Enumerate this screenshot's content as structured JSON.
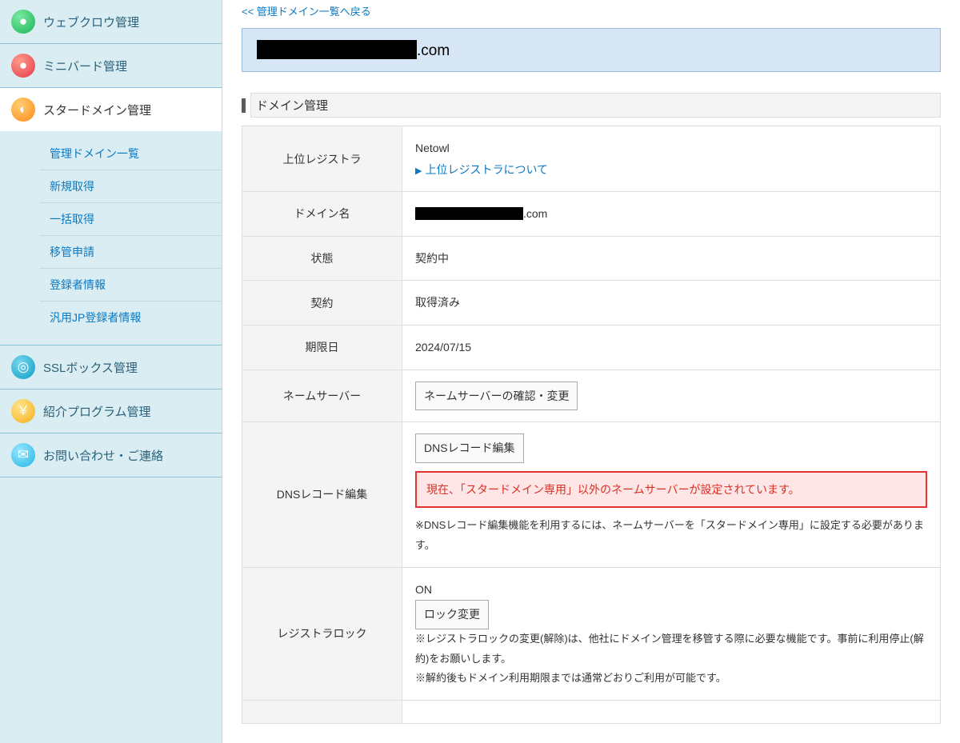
{
  "sidebar": {
    "group0": {
      "label": "ウェブクロウ管理",
      "icon": "●"
    },
    "group1": {
      "label": "ミニバード管理",
      "icon": "●"
    },
    "group2": {
      "label": "スタードメイン管理",
      "icon": "◐"
    },
    "sub": {
      "a": "管理ドメイン一覧",
      "b": "新規取得",
      "c": "一括取得",
      "d": "移管申請",
      "e": "登録者情報",
      "f": "汎用JP登録者情報"
    },
    "group3": {
      "label": "SSLボックス管理",
      "icon": "◎"
    },
    "group4": {
      "label": "紹介プログラム管理",
      "icon": "¥"
    },
    "group5": {
      "label": "お問い合わせ・ご連絡",
      "icon": "✉"
    }
  },
  "main": {
    "back": "<< 管理ドメイン一覧へ戻る",
    "domain_suffix": ".com",
    "section": "ドメイン管理",
    "rows": {
      "registrar_label": "上位レジストラ",
      "registrar_value": "Netowl",
      "registrar_link": "上位レジストラについて",
      "domain_label": "ドメイン名",
      "domain_suffix": ".com",
      "state_label": "状態",
      "state_value": "契約中",
      "contract_label": "契約",
      "contract_value": "取得済み",
      "expire_label": "期限日",
      "expire_value": "2024/07/15",
      "ns_label": "ネームサーバー",
      "ns_button": "ネームサーバーの確認・変更",
      "dns_label": "DNSレコード編集",
      "dns_button": "DNSレコード編集",
      "dns_alert": "現在、「スタードメイン専用」以外のネームサーバーが設定されています。",
      "dns_note": "※DNSレコード編集機能を利用するには、ネームサーバーを「スタードメイン専用」に設定する必要があります。",
      "lock_label": "レジストラロック",
      "lock_value": "ON",
      "lock_button": "ロック変更",
      "lock_note1": "※レジストラロックの変更(解除)は、他社にドメイン管理を移管する際に必要な機能です。事前に利用停止(解約)をお願いします。",
      "lock_note2": "※解約後もドメイン利用期限までは通常どおりご利用が可能です。"
    }
  }
}
